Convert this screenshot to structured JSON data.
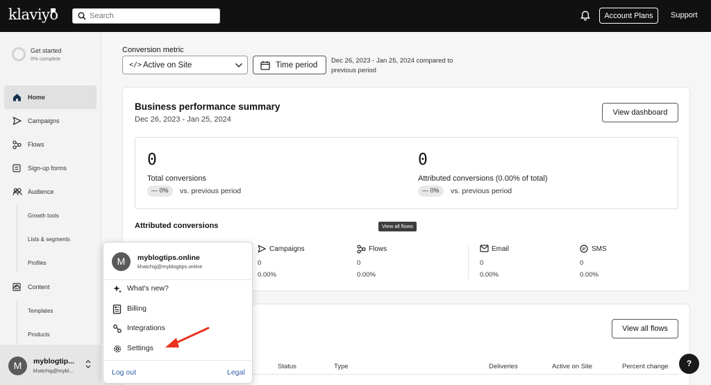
{
  "header": {
    "logo": "klaviyo",
    "search_placeholder": "Search",
    "icons": {
      "search": "search-icon",
      "notifications": "bell-icon"
    },
    "account_plans_label": "Account Plans",
    "support_label": "Support"
  },
  "sidebar": {
    "get_started": {
      "title": "Get started",
      "progress_text": "0% complete",
      "progress": 0
    },
    "home": "Home",
    "campaigns": "Campaigns",
    "flows": "Flows",
    "signup_forms": "Sign-up forms",
    "audience": {
      "label": "Audience",
      "items": [
        "Growth tools",
        "Lists & segments",
        "Profiles"
      ]
    },
    "content": {
      "label": "Content",
      "items": [
        "Templates",
        "Products"
      ]
    },
    "user": {
      "initial": "M",
      "name": "myblogtip...",
      "email": "khatchig@mybl..."
    }
  },
  "filters": {
    "conversion_metric_label": "Conversion metric",
    "conversion_metric_value": "Active on Site",
    "time_period_label": "Time period",
    "range_note": "Dec 26, 2023 - Jan 25, 2024 compared to previous period"
  },
  "summary": {
    "title": "Business performance summary",
    "range": "Dec 26, 2023 - Jan 25, 2024",
    "view_dashboard": "View dashboard",
    "total": {
      "value": "0",
      "label": "Total conversions",
      "change": "— 0%",
      "vs": "vs. previous period"
    },
    "attributed": {
      "value": "0",
      "label": "Attributed conversions (0.00% of total)",
      "change": "— 0%",
      "vs": "vs. previous period"
    },
    "attributed_title": "Attributed conversions",
    "columns": [
      {
        "label": "Campaigns",
        "count": "0",
        "pct": "0.00%"
      },
      {
        "label": "Flows",
        "count": "0",
        "pct": "0.00%"
      },
      {
        "label": "Email",
        "count": "0",
        "pct": "0.00%"
      },
      {
        "label": "SMS",
        "count": "0",
        "pct": "0.00%"
      }
    ]
  },
  "tooltip": "View all flows",
  "flows_card": {
    "view_all_flows": "View all flows",
    "headers": [
      "Status",
      "Type",
      "Deliveries",
      "Active on Site",
      "Percent change"
    ]
  },
  "help_label": "?",
  "popup": {
    "initial": "M",
    "name": "myblogtips.online",
    "email": "khatchig@myblogtips.online",
    "items": [
      "What's new?",
      "Billing",
      "Integrations",
      "Settings"
    ],
    "logout": "Log out",
    "legal": "Legal"
  },
  "colors": {
    "topbar": "#111111",
    "link": "#2f5ea8",
    "annotation_arrow": "#e8321e"
  }
}
